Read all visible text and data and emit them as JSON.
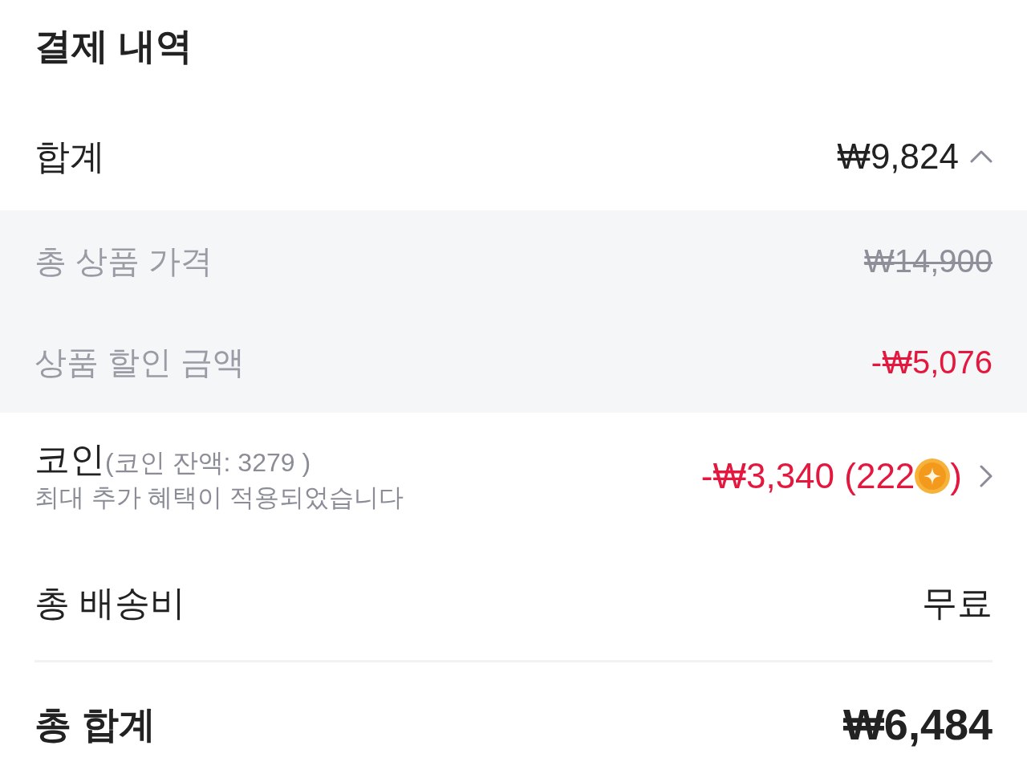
{
  "title": "결제 내역",
  "subtotal": {
    "label": "합계",
    "value": "₩9,824",
    "expanded": true
  },
  "breakdown": [
    {
      "label": "총 상품 가격",
      "value": "₩14,900",
      "kind": "original"
    },
    {
      "label": "상품 할인 금액",
      "value": "-₩5,076",
      "kind": "discount"
    }
  ],
  "coins": {
    "label": "코인",
    "balance": "(코인 잔액: 3279 )",
    "note": "최대 추가 혜택이 적용되었습니다",
    "amount": "-₩3,340 (222",
    "amount_end": ")"
  },
  "shipping": {
    "label": "총 배송비",
    "value": "무료"
  },
  "total": {
    "label": "총 합계",
    "value": "₩6,484"
  }
}
